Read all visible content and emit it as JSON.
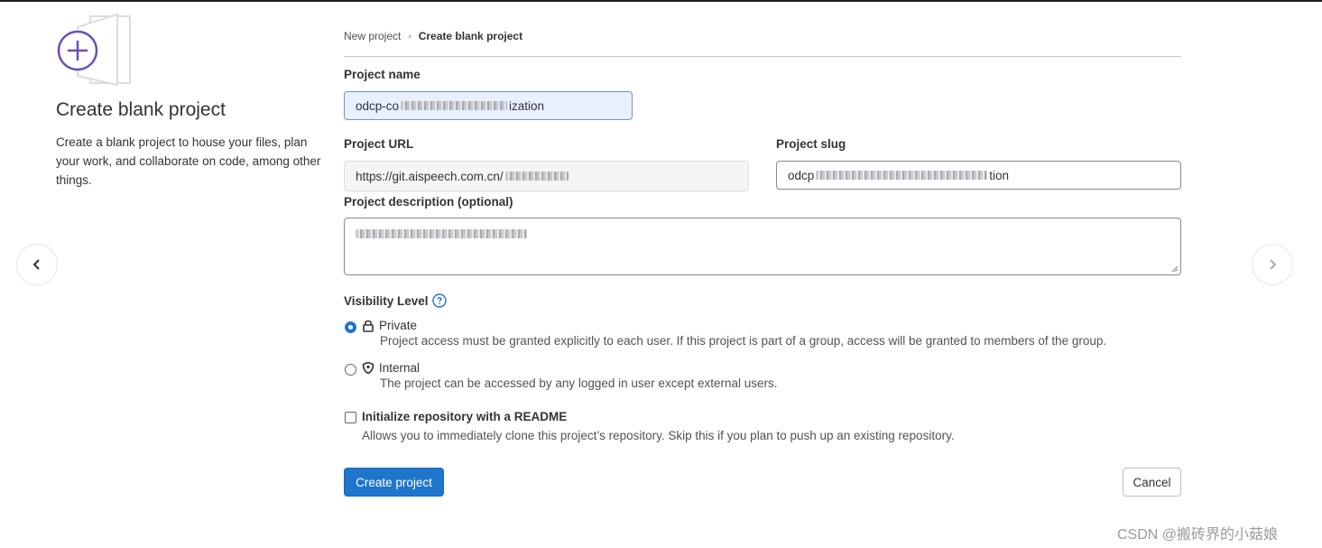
{
  "breadcrumb": {
    "parent": "New project",
    "current": "Create blank project"
  },
  "left_panel": {
    "icon": "plus-circle-icon",
    "title": "Create blank project",
    "description": "Create a blank project to house your files, plan your work, and collaborate on code, among other things."
  },
  "form": {
    "project_name": {
      "label": "Project name",
      "value_start": "odcp-co",
      "value_end": "ization"
    },
    "project_url": {
      "label": "Project URL",
      "value": "https://git.aispeech.com.cn/"
    },
    "project_slug": {
      "label": "Project slug",
      "value_start": "odcp",
      "value_end": "tion"
    },
    "description": {
      "label": "Project description (optional)"
    },
    "visibility": {
      "label": "Visibility Level",
      "help_icon": "question-circle-icon",
      "options": [
        {
          "label": "Private",
          "icon": "lock-icon",
          "checked": true,
          "help": "Project access must be granted explicitly to each user. If this project is part of a group, access will be granted to members of the group."
        },
        {
          "label": "Internal",
          "icon": "shield-icon",
          "checked": false,
          "help": "The project can be accessed by any logged in user except external users."
        }
      ]
    },
    "readme": {
      "label": "Initialize repository with a README",
      "checked": false,
      "help": "Allows you to immediately clone this project’s repository. Skip this if you plan to push up an existing repository."
    }
  },
  "actions": {
    "create_label": "Create project",
    "cancel_label": "Cancel"
  },
  "nav": {
    "prev_icon": "chevron-left-icon",
    "next_icon": "chevron-right-icon"
  },
  "watermark": "CSDN @搬砖界的小菇娘",
  "colors": {
    "primary": "#1f75cb",
    "accent": "#6b4fbb",
    "text": "#333238"
  }
}
